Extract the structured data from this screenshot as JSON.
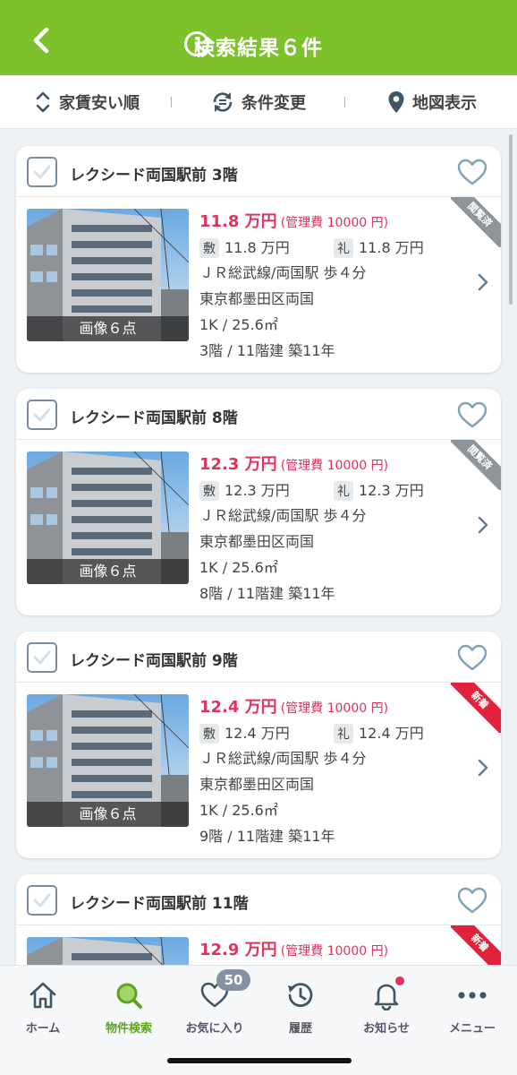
{
  "header": {
    "title": "検索結果６件"
  },
  "toolbar": {
    "sort_label": "家賃安い順",
    "conditions_label": "条件変更",
    "map_label": "地図表示"
  },
  "cards": [
    {
      "name": "レクシード両国駅前 3階",
      "photo_caption": "画像６点",
      "rent": "11.8 万円",
      "management": "(管理費 10000 円)",
      "deposit_tag": "敷",
      "deposit": "11.8 万円",
      "key_money_tag": "礼",
      "key_money": "11.8 万円",
      "access": "ＪＲ総武線/両国駅 歩４分",
      "address": "東京都墨田区両国",
      "layout": "1K / 25.6㎡",
      "floor": "3階 / 11階建 築11年",
      "ribbon": "閲覧済",
      "ribbon_type": "viewed"
    },
    {
      "name": "レクシード両国駅前 8階",
      "photo_caption": "画像６点",
      "rent": "12.3 万円",
      "management": "(管理費 10000 円)",
      "deposit_tag": "敷",
      "deposit": "12.3 万円",
      "key_money_tag": "礼",
      "key_money": "12.3 万円",
      "access": "ＪＲ総武線/両国駅 歩４分",
      "address": "東京都墨田区両国",
      "layout": "1K / 25.6㎡",
      "floor": "8階 / 11階建 築11年",
      "ribbon": "閲覧済",
      "ribbon_type": "viewed"
    },
    {
      "name": "レクシード両国駅前 9階",
      "photo_caption": "画像６点",
      "rent": "12.4 万円",
      "management": "(管理費 10000 円)",
      "deposit_tag": "敷",
      "deposit": "12.4 万円",
      "key_money_tag": "礼",
      "key_money": "12.4 万円",
      "access": "ＪＲ総武線/両国駅 歩４分",
      "address": "東京都墨田区両国",
      "layout": "1K / 25.6㎡",
      "floor": "9階 / 11階建 築11年",
      "ribbon": "新着",
      "ribbon_type": "new"
    },
    {
      "name": "レクシード両国駅前 11階",
      "photo_caption": "画像６点",
      "rent": "12.9 万円",
      "management": "(管理費 10000 円)",
      "deposit_tag": "",
      "deposit": "",
      "key_money_tag": "",
      "key_money": "",
      "access": "",
      "address": "",
      "layout": "",
      "floor": "",
      "ribbon": "新着",
      "ribbon_type": "new"
    }
  ],
  "bottom_nav": [
    {
      "label": "ホーム",
      "icon": "home-icon",
      "active": false
    },
    {
      "label": "物件検索",
      "icon": "search-icon",
      "active": true
    },
    {
      "label": "お気に入り",
      "icon": "heart-icon",
      "active": false,
      "badge": "50"
    },
    {
      "label": "履歴",
      "icon": "history-icon",
      "active": false
    },
    {
      "label": "お知らせ",
      "icon": "bell-icon",
      "active": false,
      "has_dot": true
    },
    {
      "label": "メニュー",
      "icon": "more-icon",
      "active": false
    }
  ],
  "colors": {
    "header_green": "#7dc12b",
    "price_pink": "#e0335c",
    "new_red": "#e0223a",
    "viewed_gray": "#8e969c"
  }
}
